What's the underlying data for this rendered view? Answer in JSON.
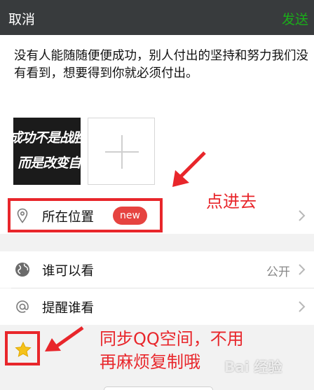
{
  "header": {
    "cancel_label": "取消",
    "send_label": "发送"
  },
  "compose": {
    "text": "没有人能随随便便成功，别人付出的坚持和努力我们没有看到，想要得到你就必须付出。",
    "image_caption_line1": "成功不是战胜别人",
    "image_caption_line2": "而是改变自己"
  },
  "location_row": {
    "label": "所在位置",
    "badge": "new",
    "icon": "location-pin-icon"
  },
  "visibility_row": {
    "label": "谁可以看",
    "value": "公开",
    "icon": "globe-icon"
  },
  "mention_row": {
    "label": "提醒谁看",
    "icon": "at-icon"
  },
  "annotations": {
    "tap_hint": "点进去",
    "qq_sync_line1": "同步QQ空间，不用",
    "qq_sync_line2": "再麻烦复制哦"
  },
  "watermark": "Bai 经验",
  "colors": {
    "header_bg": "#383b3d",
    "send_green": "#1aad19",
    "annotation_red": "#e8262b",
    "badge_red": "#e64340"
  }
}
